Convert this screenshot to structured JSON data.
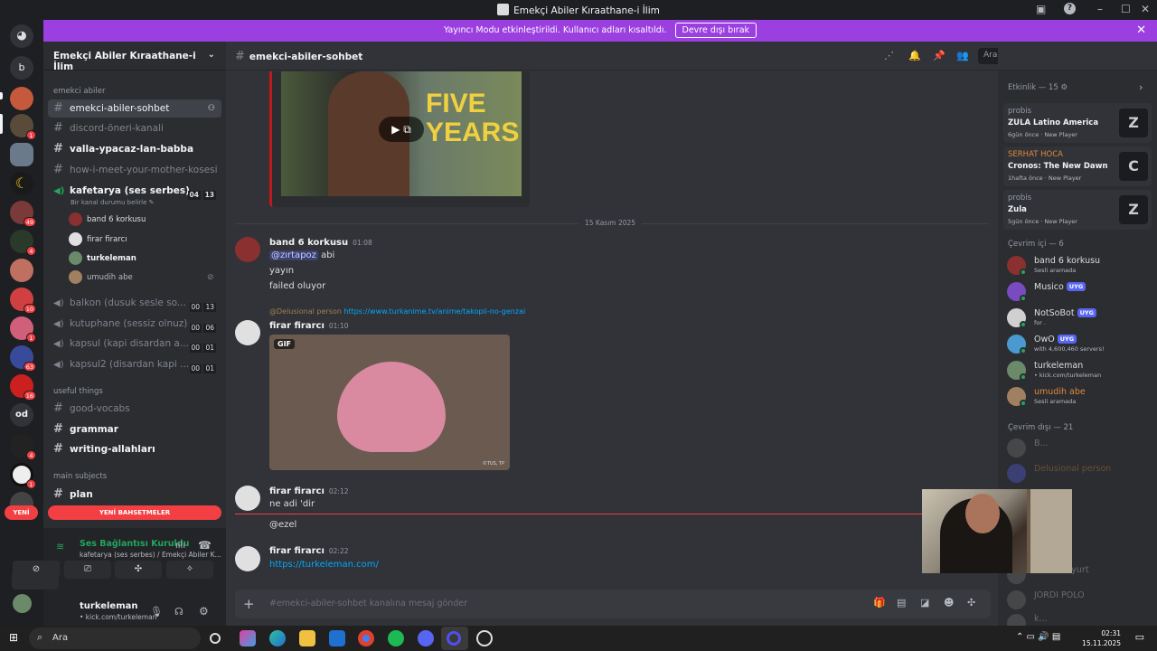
{
  "window": {
    "title": "Emekçi Abiler Kıraathane-i İlim"
  },
  "banner": {
    "text": "Yayıncı Modu etkinleştirildi. Kullanıcı adları kısaltıldı.",
    "button": "Devre dışı bırak"
  },
  "rail": {
    "home_label": "b",
    "od_label": "od",
    "badges": [
      "1",
      "49",
      "4",
      "10",
      "1",
      "63",
      "16",
      "4",
      "1",
      "1"
    ]
  },
  "guild": {
    "name": "Emekçi Abiler Kıraathane-i İlim"
  },
  "categories": {
    "c1": "emekci abiler",
    "c2": "useful things",
    "c3": "main subjects"
  },
  "channels": {
    "ch1": "emekci-abiler-sohbet",
    "ch2": "discord-öneri-kanali",
    "ch3": "valla-ypacaz-lan-babba",
    "ch4": "how-i-meet-your-mother-kosesi",
    "ch5": "kafetarya (ses serbes)",
    "ch5_counts": [
      "04",
      "13"
    ],
    "ch5_status": "Bir kanal durumu belirle",
    "ch6": "balkon (dusuk sesle so...",
    "ch6_counts": [
      "00",
      "13"
    ],
    "ch7": "kutuphane (sessiz olnuz)",
    "ch7_counts": [
      "00",
      "06"
    ],
    "ch8": "kapsul (kapi disardan a...",
    "ch8_counts": [
      "00",
      "01"
    ],
    "ch9": "kapsul2 (disardan kapi ...",
    "ch9_counts": [
      "00",
      "01"
    ],
    "ch10": "good-vocabs",
    "ch11": "grammar",
    "ch12": "writing-allahları",
    "ch13": "plan"
  },
  "voice_users": [
    "band 6 korkusu",
    "firar firarcı",
    "turkeleman",
    "umudih abe"
  ],
  "new_pills": {
    "left": "YENİ",
    "right": "YENİ BAHSETMELER"
  },
  "voice_panel": {
    "status": "Ses Bağlantısı Kuruldu",
    "channel": "kafetarya (ses serbes) / Emekçi Abiler K..."
  },
  "user": {
    "name": "turkeleman",
    "sub": "• kick.com/turkeleman"
  },
  "chat": {
    "channel": "emekci-abiler-sohbet",
    "search_placeholder": "Ara",
    "video_text_1": "FIVE",
    "video_text_2": "YEARS",
    "date_divider": "15 Kasım 2025",
    "msg1": {
      "author": "band 6 korkusu",
      "time": "01:08",
      "mention": "@zırtapoz",
      "line1_rest": " abi",
      "line2": "yayın",
      "line3": "failed oluyor"
    },
    "msg2": {
      "reply_user": "@Delusional person",
      "reply_link": "https://www.turkanime.tv/anime/takopii-no-genzai",
      "author": "firar firarcı",
      "time": "01:10",
      "gif_label": "GIF",
      "gif_credit": "©TUS, TP"
    },
    "msg3": {
      "author": "firar firarcı",
      "time": "02:12",
      "line1": "ne adi 'dir",
      "line2": "@ezel"
    },
    "msg4": {
      "author": "firar firarcı",
      "time": "02:22",
      "link": "https://turkeleman.com/"
    },
    "composer_placeholder": "#emekci-abiler-sohbet kanalına mesaj gönder"
  },
  "activity": {
    "header": "Etkinlik — 15",
    "cards": [
      {
        "user": "probis",
        "game": "ZULA Latino America",
        "meta": "6gün önce  ·  New Player",
        "thumb": "Z"
      },
      {
        "user": "SERHAT HOCA",
        "game": "Cronos: The New Dawn",
        "meta": "1hafta önce  ·  New Player",
        "thumb": "C"
      },
      {
        "user": "probis",
        "game": "Zula",
        "meta": "5gün önce  ·  New Player",
        "thumb": "Z"
      }
    ],
    "online_header": "Çevrim içi — 6",
    "online": [
      {
        "name": "band 6 korkusu",
        "status": "Sesli aramada"
      },
      {
        "name": "Musico",
        "status": "",
        "tag": "UYG"
      },
      {
        "name": "NotSoBot",
        "status": "for .",
        "tag": "UYG"
      },
      {
        "name": "OwO",
        "status": "with 4,600,460 servers!",
        "tag": "UYG"
      },
      {
        "name": "turkeleman",
        "status": "• kick.com/turkeleman"
      },
      {
        "name": "umudih abe",
        "status": "Sesli aramada"
      }
    ],
    "offline_header": "Çevrim dışı — 21",
    "offline": [
      "B...",
      "Delusional person",
      "",
      "hen... nliyurt",
      "JORDI POLO",
      "k..."
    ]
  },
  "taskbar": {
    "search": "Ara",
    "time": "02:31",
    "date": "15.11.2025"
  },
  "colors": {
    "accent": "#5865f2",
    "banner": "#9b3fe0",
    "online": "#23a55a",
    "danger": "#f23f43",
    "link": "#00a8fc"
  }
}
